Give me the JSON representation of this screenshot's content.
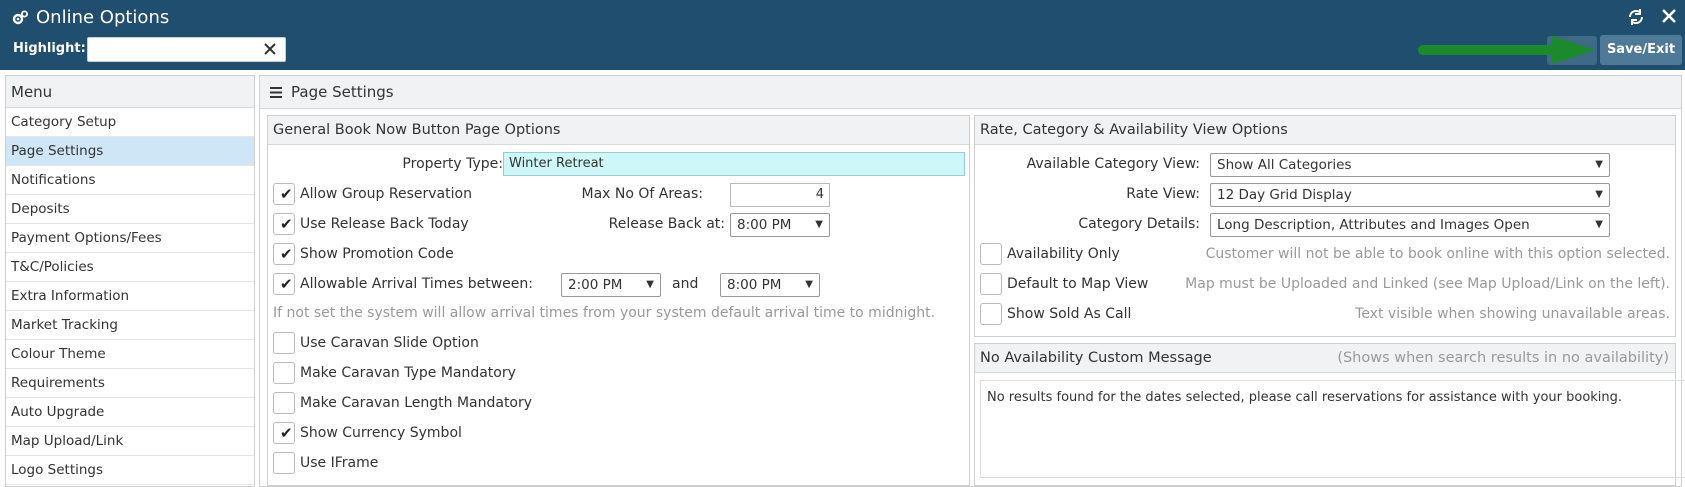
{
  "window": {
    "title": "Online Options",
    "title_icon": "gears-icon",
    "refresh_icon": "refresh-icon",
    "close_icon": "close-icon"
  },
  "highlight": {
    "label": "Highlight:",
    "value": "",
    "placeholder": ""
  },
  "toolbar": {
    "save_exit_label": "Save/Exit"
  },
  "menu": {
    "header": "Menu",
    "items": [
      {
        "label": "Category Setup"
      },
      {
        "label": "Page Settings",
        "active": true
      },
      {
        "label": "Notifications"
      },
      {
        "label": "Deposits"
      },
      {
        "label": "Payment Options/Fees"
      },
      {
        "label": "T&C/Policies"
      },
      {
        "label": "Extra Information"
      },
      {
        "label": "Market Tracking"
      },
      {
        "label": "Colour Theme"
      },
      {
        "label": "Requirements"
      },
      {
        "label": "Auto Upgrade"
      },
      {
        "label": "Map Upload/Link"
      },
      {
        "label": "Logo Settings"
      }
    ]
  },
  "main": {
    "title": "Page Settings"
  },
  "general": {
    "title": "General Book Now Button Page Options",
    "property_type_label": "Property Type:",
    "property_type_value": "Winter Retreat",
    "allow_group_label": "Allow Group Reservation",
    "allow_group_checked": true,
    "max_areas_label": "Max No Of Areas:",
    "max_areas_value": "4",
    "release_back_label": "Use Release Back Today",
    "release_back_checked": true,
    "release_at_label": "Release Back at:",
    "release_at_value": "8:00 PM",
    "promo_label": "Show Promotion Code",
    "promo_checked": true,
    "arrival_label": "Allowable Arrival Times between:",
    "arrival_checked": true,
    "arrival_from": "2:00 PM",
    "arrival_and": "and",
    "arrival_to": "8:00 PM",
    "arrival_note": "If not set the system will allow arrival times from your system default arrival time to midnight.",
    "caravan_slide_label": "Use Caravan Slide Option",
    "caravan_slide_checked": false,
    "caravan_type_label": "Make Caravan Type Mandatory",
    "caravan_type_checked": false,
    "caravan_length_label": "Make Caravan Length Mandatory",
    "caravan_length_checked": false,
    "currency_label": "Show Currency Symbol",
    "currency_checked": true,
    "iframe_label": "Use IFrame",
    "iframe_checked": false
  },
  "rate_view": {
    "title": "Rate, Category & Availability View Options",
    "category_view_label": "Available Category View:",
    "category_view_value": "Show All Categories",
    "rate_view_label": "Rate View:",
    "rate_view_value": "12 Day Grid Display",
    "category_details_label": "Category Details:",
    "category_details_value": "Long Description, Attributes and Images Open",
    "availability_only_label": "Availability Only",
    "availability_only_checked": false,
    "availability_only_note": "Customer will not be able to book online with this option selected.",
    "map_view_label": "Default to Map View",
    "map_view_checked": false,
    "map_view_note": "Map must be Uploaded and Linked (see Map Upload/Link on the left).",
    "sold_as_call_label": "Show Sold As Call",
    "sold_as_call_checked": false,
    "sold_as_call_note": "Text visible when showing unavailable areas."
  },
  "no_availability": {
    "title": "No Availability Custom Message",
    "hint": "(Shows when search results in no availability)",
    "message": "No results found for the dates selected, please call reservations for assistance with your booking."
  },
  "colors": {
    "topbar": "#1f4e6e",
    "save_button": "#4f7a97",
    "active_menu": "#cfe6f7",
    "property_input": "#cef7f7",
    "arrow": "#1a8a2a"
  },
  "annotation": {
    "arrow_icon": "green-arrow-icon"
  }
}
